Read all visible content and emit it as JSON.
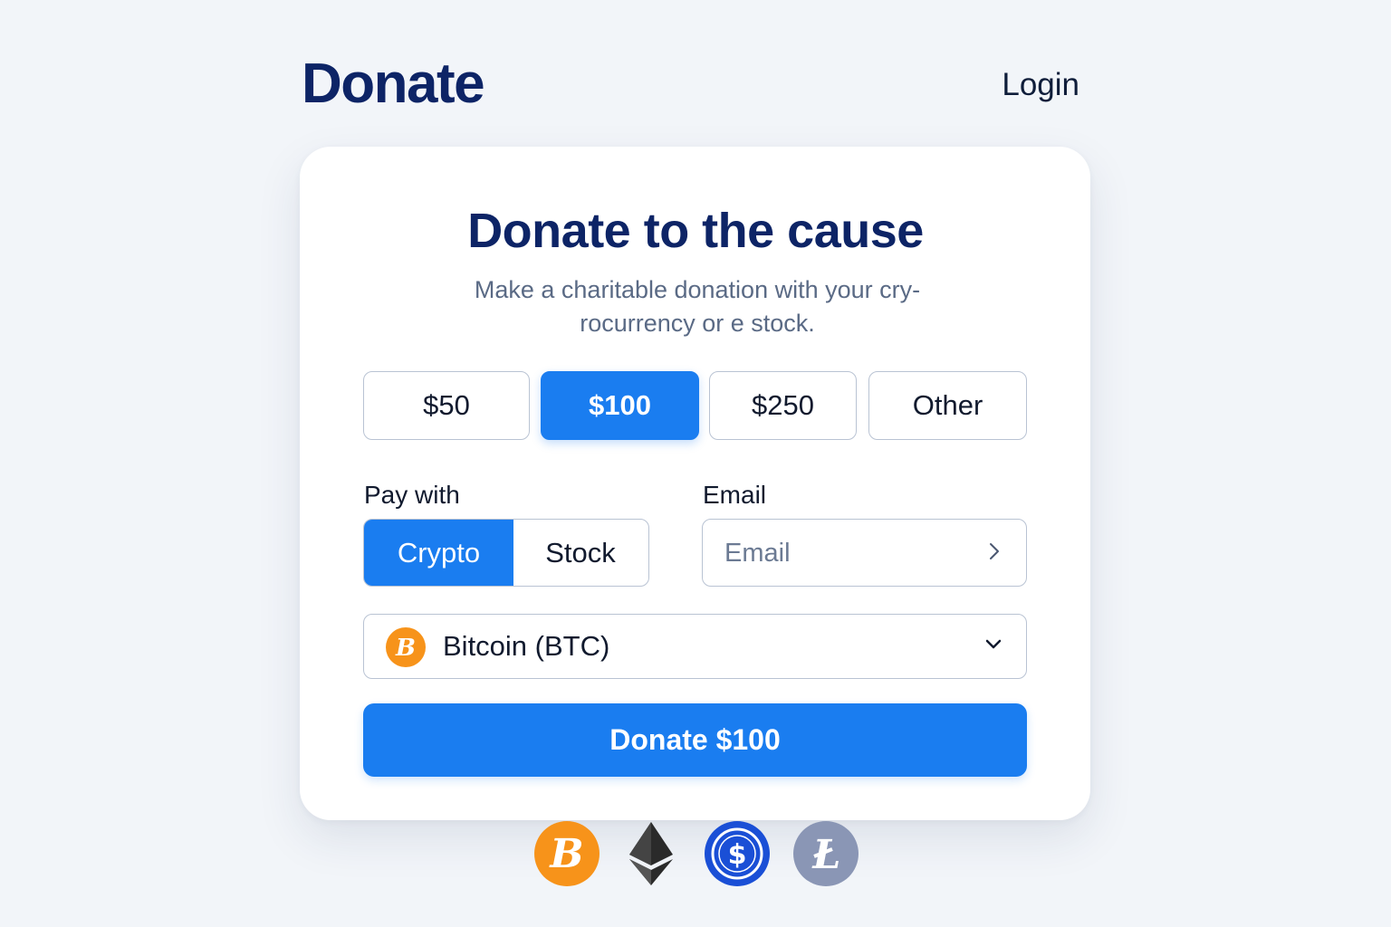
{
  "header": {
    "brand": "Donate",
    "login_label": "Login"
  },
  "card": {
    "title": "Donate to the cause",
    "subtitle_line1": "Make a charitable donation with your cry-",
    "subtitle_line2": "rocurrency or e stock."
  },
  "amounts": {
    "options": [
      "$50",
      "$100",
      "$250",
      "Other"
    ],
    "selected": "$100"
  },
  "pay_with": {
    "label": "Pay with",
    "options": [
      "Crypto",
      "Stock"
    ],
    "selected": "Crypto"
  },
  "email": {
    "label": "Email",
    "placeholder": "Email",
    "value": ""
  },
  "currency_select": {
    "selected": "Bitcoin (BTC)",
    "icon": "bitcoin-icon"
  },
  "donate_button": {
    "label": "Donate $100"
  },
  "supported_coins": [
    {
      "name": "bitcoin-icon",
      "color": "#f7931a"
    },
    {
      "name": "ethereum-icon",
      "color": "#1f1f1f"
    },
    {
      "name": "usdc-icon",
      "color": "#1a4fd6"
    },
    {
      "name": "litecoin-icon",
      "color": "#8a96b5"
    }
  ],
  "colors": {
    "accent": "#1a7df0",
    "brand_navy": "#0d2466",
    "background": "#f2f5f9"
  }
}
